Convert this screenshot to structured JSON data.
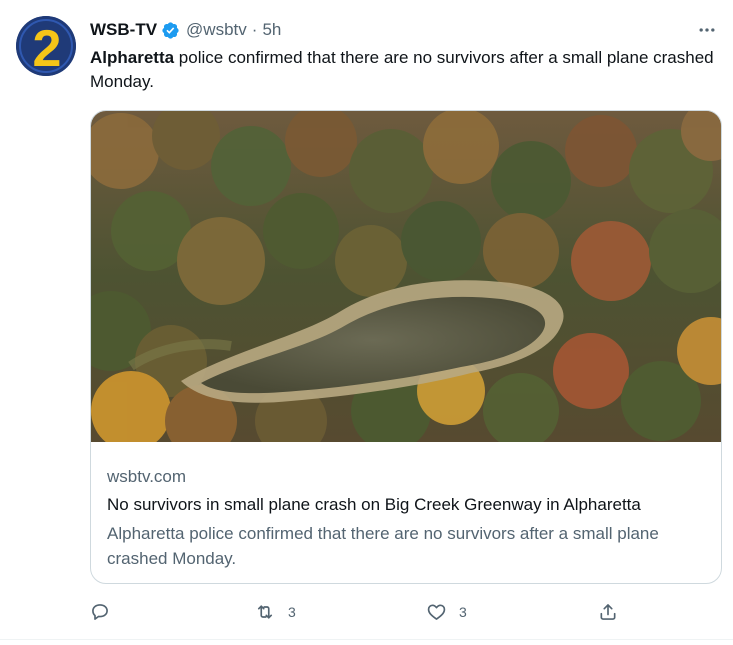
{
  "tweet": {
    "display_name": "WSB-TV",
    "verified": true,
    "handle": "@wsbtv",
    "separator": "·",
    "time": "5h",
    "text_bold": "Alpharetta",
    "text_rest": " police confirmed that there are no survivors after a small plane crashed Monday.",
    "avatar_icon": "wsb-channel-2-logo",
    "more_icon": "more-horizontal-icon"
  },
  "card": {
    "image_description_icon": "aerial-pond-forest-photo",
    "domain": "wsbtv.com",
    "title": "No survivors in small plane crash on Big Creek Greenway in Alpharetta",
    "description": "Alpharetta police confirmed that there are no survivors after a small plane crashed Monday."
  },
  "actions": {
    "reply": {
      "icon": "reply-icon",
      "count": ""
    },
    "retweet": {
      "icon": "retweet-icon",
      "count": "3"
    },
    "like": {
      "icon": "heart-icon",
      "count": "3"
    },
    "share": {
      "icon": "share-icon",
      "count": ""
    }
  },
  "colors": {
    "text_primary": "#0f1419",
    "text_secondary": "#536471",
    "border": "#cfd9de",
    "verified_blue": "#1d9bf0",
    "avatar_blue": "#1f3a78",
    "avatar_yellow": "#f5c518"
  }
}
